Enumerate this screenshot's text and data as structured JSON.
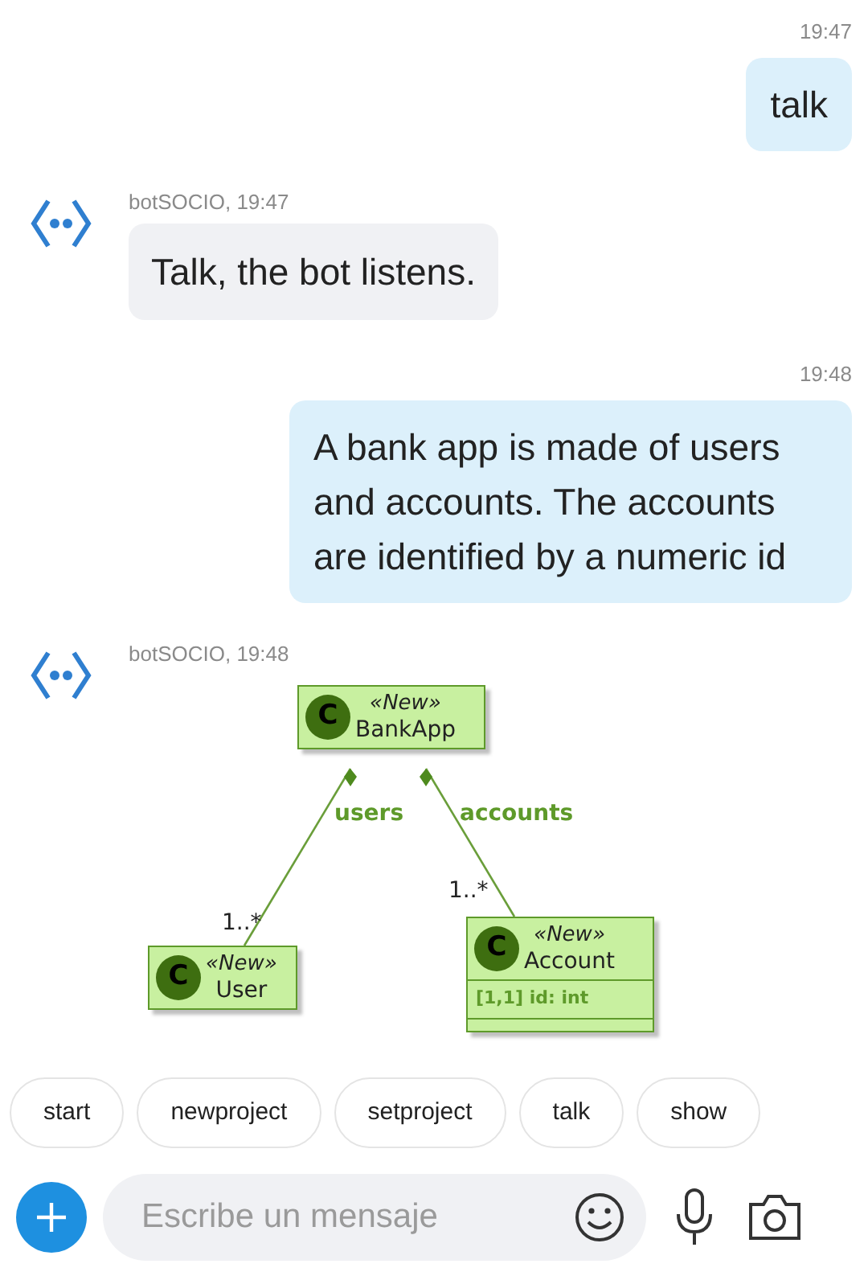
{
  "messages": [
    {
      "kind": "user",
      "time": "19:47",
      "text": "talk"
    },
    {
      "kind": "bot",
      "sender": "botSOCIO, 19:47",
      "text": "Talk, the bot listens."
    },
    {
      "kind": "user",
      "time": "19:48",
      "text": "A bank app is made of users and accounts. The accounts are identified by a numeric id"
    },
    {
      "kind": "diagram",
      "sender": "botSOCIO, 19:48",
      "diagram": {
        "classes": [
          {
            "letter": "C",
            "stereotype": "«New»",
            "name": "BankApp"
          },
          {
            "letter": "C",
            "stereotype": "«New»",
            "name": "User"
          },
          {
            "letter": "C",
            "stereotype": "«New»",
            "name": "Account",
            "attributes": [
              "[1,1] id: int"
            ]
          }
        ],
        "associations": [
          {
            "label": "users",
            "multiplicity": "1..*"
          },
          {
            "label": "accounts",
            "multiplicity": "1..*"
          }
        ]
      }
    }
  ],
  "suggestions": [
    "start",
    "newproject",
    "setproject",
    "talk",
    "show"
  ],
  "composer": {
    "placeholder": "Escribe un mensaje"
  }
}
